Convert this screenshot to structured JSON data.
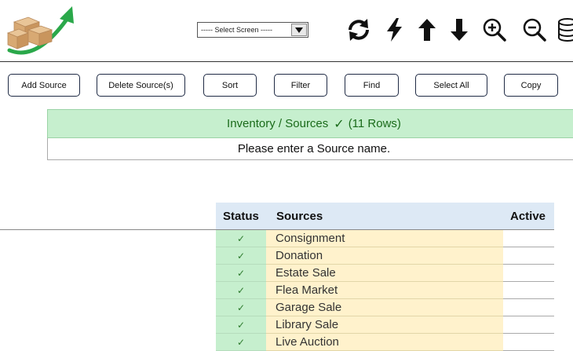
{
  "header": {
    "screen_select": {
      "value": "----- Select Screen -----"
    },
    "toolbar_icons": [
      "refresh-icon",
      "lightning-icon",
      "arrow-up-icon",
      "arrow-down-icon",
      "zoom-in-icon",
      "zoom-out-icon",
      "database-icon"
    ]
  },
  "actions": {
    "add_source": "Add Source",
    "delete_sources": "Delete Source(s)",
    "sort": "Sort",
    "filter": "Filter",
    "find": "Find",
    "select_all": "Select All",
    "copy": "Copy"
  },
  "title_bar": {
    "title": "Inventory / Sources",
    "check": "✓",
    "count": "(11 Rows)"
  },
  "message": "Please enter a Source name.",
  "grid": {
    "columns": {
      "status": "Status",
      "sources": "Sources",
      "active": "Active"
    },
    "rows": [
      {
        "status": "✓",
        "source": "Consignment",
        "active": ""
      },
      {
        "status": "✓",
        "source": "Donation",
        "active": ""
      },
      {
        "status": "✓",
        "source": "Estate Sale",
        "active": ""
      },
      {
        "status": "✓",
        "source": "Flea Market",
        "active": ""
      },
      {
        "status": "✓",
        "source": "Garage Sale",
        "active": ""
      },
      {
        "status": "✓",
        "source": "Library Sale",
        "active": ""
      },
      {
        "status": "✓",
        "source": "Live Auction",
        "active": ""
      }
    ]
  },
  "colors": {
    "title_green_bg": "#c6efce",
    "title_green_text": "#1a6b1a",
    "source_cell_bg": "#fff2cc",
    "header_bg": "#dde9f5",
    "button_border": "#1f2a44"
  }
}
